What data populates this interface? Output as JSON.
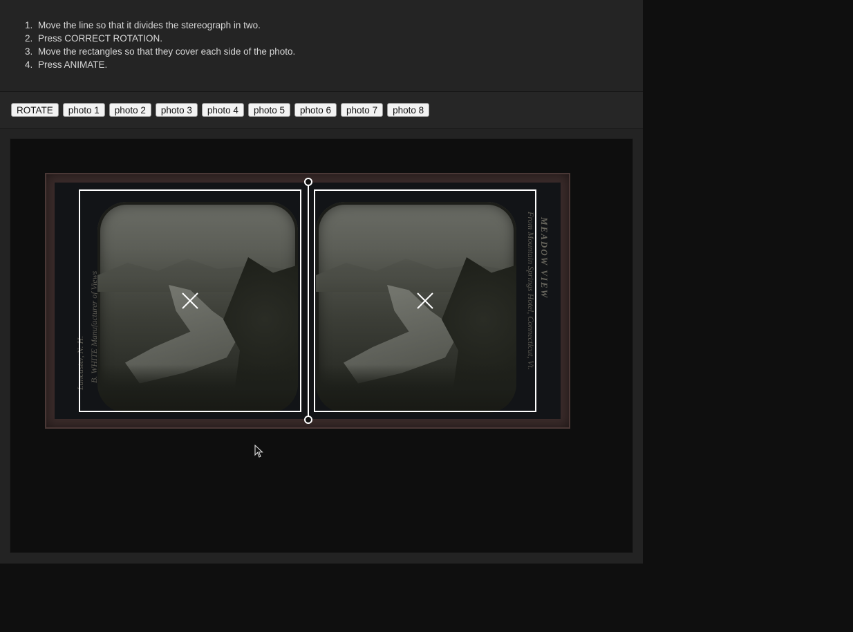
{
  "instructions": {
    "steps": [
      {
        "num": "1.",
        "text": "Move the line so that it divides the stereograph in two."
      },
      {
        "num": "2.",
        "text": "Press CORRECT ROTATION."
      },
      {
        "num": "3.",
        "text": "Move the rectangles so that they cover each side of the photo."
      },
      {
        "num": "4.",
        "text": "Press ANIMATE."
      }
    ]
  },
  "toolbar": {
    "rotate_label": "ROTATE",
    "photo_buttons": [
      "photo 1",
      "photo 2",
      "photo 3",
      "photo 4",
      "photo 5",
      "photo 6",
      "photo 7",
      "photo 8"
    ]
  },
  "stereograph": {
    "left_side_text": "Lancaster, N. H.",
    "left_side_text_2": "B. WHITE  Manufacturer of Views",
    "right_title": "MEADOW VIEW",
    "right_side_text": "From Mountain Springs Hotel, Connecticut, Vt."
  },
  "colors": {
    "page_bg": "#0f0f0f",
    "panel_bg": "#232323",
    "stage_bg": "#0e0e0e",
    "overlay": "#ffffff",
    "button_bg": "#f3f3f3"
  },
  "icons": {
    "crop_center": "close-x-icon",
    "divider_handle": "circle-handle-icon",
    "pointer": "mouse-pointer-icon"
  }
}
